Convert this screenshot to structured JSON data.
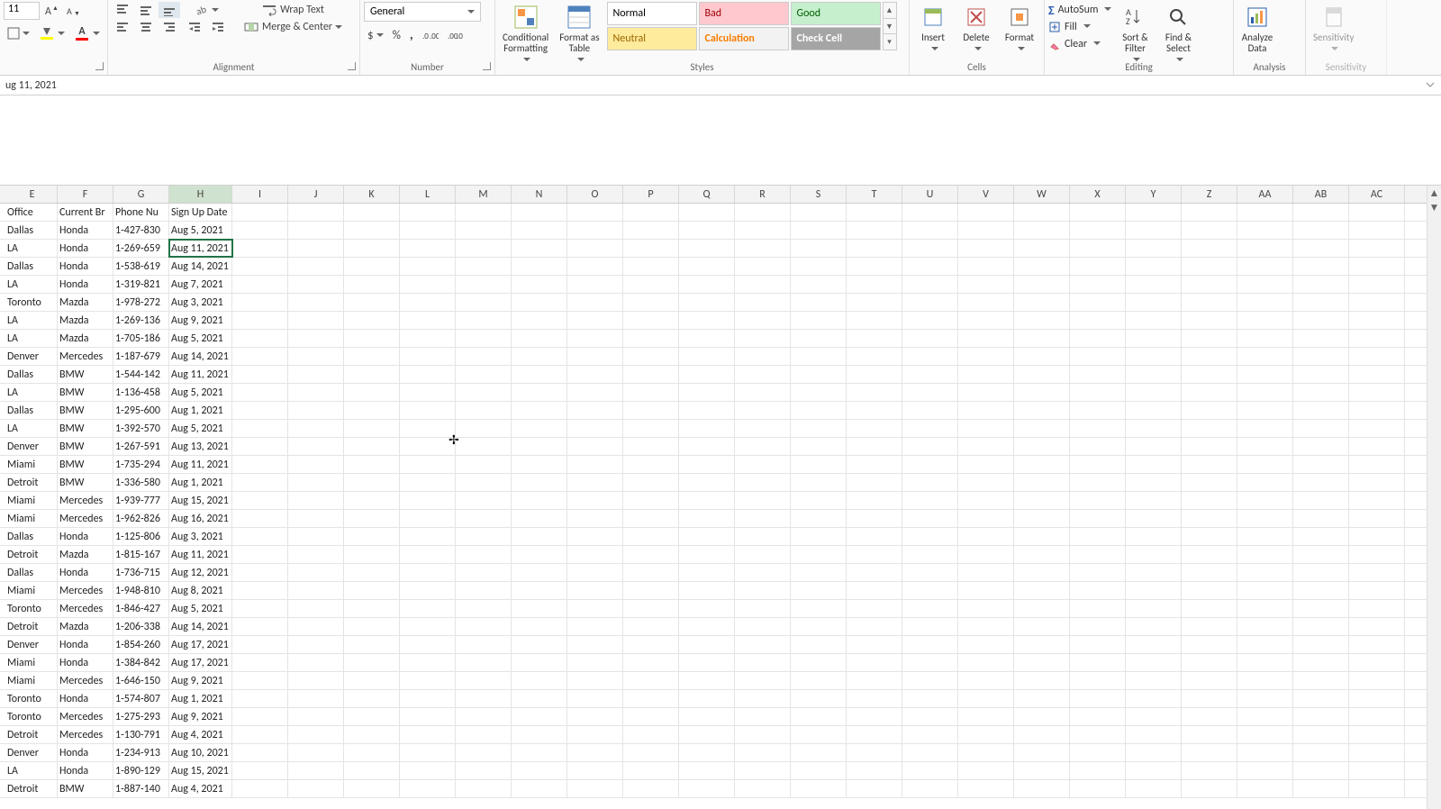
{
  "font": {
    "size": "11"
  },
  "wrap_text_label": "Wrap Text",
  "merge_center_label": "Merge & Center",
  "alignment_label": "Alignment",
  "number_format": "General",
  "number_label": "Number",
  "cond_format_label": "Conditional\nFormatting",
  "format_table_label": "Format as\nTable",
  "styles": {
    "normal": "Normal",
    "bad": "Bad",
    "good": "Good",
    "neutral": "Neutral",
    "calculation": "Calculation",
    "check_cell": "Check Cell",
    "group_label": "Styles"
  },
  "cells": {
    "insert": "Insert",
    "delete": "Delete",
    "format": "Format",
    "group_label": "Cells"
  },
  "editing": {
    "autosum": "AutoSum",
    "fill": "Fill",
    "clear": "Clear",
    "sort": "Sort &\nFilter",
    "find": "Find &\nSelect",
    "group_label": "Editing"
  },
  "analysis": {
    "analyze": "Analyze\nData",
    "group_label": "Analysis"
  },
  "sensitivity": {
    "label": "Sensitivity",
    "group_label": "Sensitivity"
  },
  "formula_bar": "ug 11, 2021",
  "columns": [
    "E",
    "F",
    "G",
    "H",
    "I",
    "J",
    "K",
    "L",
    "M",
    "N",
    "O",
    "P",
    "Q",
    "R",
    "S",
    "T",
    "U",
    "V",
    "W",
    "X",
    "Y",
    "Z",
    "AA",
    "AB",
    "AC"
  ],
  "selected_column": "H",
  "header_row": {
    "E": "Office",
    "F": "Current Br",
    "G": "Phone Nu",
    "H": "Sign Up Date"
  },
  "rows": [
    {
      "E": "Dallas",
      "F": "Honda",
      "G": "1-427-830",
      "H": "Aug 5, 2021"
    },
    {
      "E": "LA",
      "F": "Honda",
      "G": "1-269-659",
      "H": "Aug 11, 2021",
      "selected": true
    },
    {
      "E": "Dallas",
      "F": "Honda",
      "G": "1-538-619",
      "H": "Aug 14, 2021"
    },
    {
      "E": "LA",
      "F": "Honda",
      "G": "1-319-821",
      "H": "Aug 7, 2021"
    },
    {
      "E": "Toronto",
      "F": "Mazda",
      "G": "1-978-272",
      "H": "Aug 3, 2021"
    },
    {
      "E": "LA",
      "F": "Mazda",
      "G": "1-269-136",
      "H": "Aug 9, 2021"
    },
    {
      "E": "LA",
      "F": "Mazda",
      "G": "1-705-186",
      "H": "Aug 5, 2021"
    },
    {
      "E": "Denver",
      "F": "Mercedes",
      "G": "1-187-679",
      "H": "Aug 14, 2021"
    },
    {
      "E": "Dallas",
      "F": "BMW",
      "G": "1-544-142",
      "H": "Aug 11, 2021"
    },
    {
      "E": "LA",
      "F": "BMW",
      "G": "1-136-458",
      "H": "Aug 5, 2021"
    },
    {
      "E": "Dallas",
      "F": "BMW",
      "G": "1-295-600",
      "H": "Aug 1, 2021"
    },
    {
      "E": "LA",
      "F": "BMW",
      "G": "1-392-570",
      "H": "Aug 5, 2021"
    },
    {
      "E": "Denver",
      "F": "BMW",
      "G": "1-267-591",
      "H": "Aug 13, 2021"
    },
    {
      "E": "Miami",
      "F": "BMW",
      "G": "1-735-294",
      "H": "Aug 11, 2021"
    },
    {
      "E": "Detroit",
      "F": "BMW",
      "G": "1-336-580",
      "H": "Aug 1, 2021"
    },
    {
      "E": "Miami",
      "F": "Mercedes",
      "G": "1-939-777",
      "H": "Aug 15, 2021"
    },
    {
      "E": "Miami",
      "F": "Mercedes",
      "G": "1-962-826",
      "H": "Aug 16, 2021"
    },
    {
      "E": "Dallas",
      "F": "Honda",
      "G": "1-125-806",
      "H": "Aug 3, 2021"
    },
    {
      "E": "Detroit",
      "F": "Mazda",
      "G": "1-815-167",
      "H": "Aug 11, 2021"
    },
    {
      "E": "Dallas",
      "F": "Honda",
      "G": "1-736-715",
      "H": "Aug 12, 2021"
    },
    {
      "E": "Miami",
      "F": "Mercedes",
      "G": "1-948-810",
      "H": "Aug 8, 2021"
    },
    {
      "E": "Toronto",
      "F": "Mercedes",
      "G": "1-846-427",
      "H": "Aug 5, 2021"
    },
    {
      "E": "Detroit",
      "F": "Mazda",
      "G": "1-206-338",
      "H": "Aug 14, 2021"
    },
    {
      "E": "Denver",
      "F": "Honda",
      "G": "1-854-260",
      "H": "Aug 17, 2021"
    },
    {
      "E": "Miami",
      "F": "Honda",
      "G": "1-384-842",
      "H": "Aug 17, 2021"
    },
    {
      "E": "Miami",
      "F": "Mercedes",
      "G": "1-646-150",
      "H": "Aug 9, 2021"
    },
    {
      "E": "Toronto",
      "F": "Honda",
      "G": "1-574-807",
      "H": "Aug 1, 2021"
    },
    {
      "E": "Toronto",
      "F": "Mercedes",
      "G": "1-275-293",
      "H": "Aug 9, 2021"
    },
    {
      "E": "Detroit",
      "F": "Mercedes",
      "G": "1-130-791",
      "H": "Aug 4, 2021"
    },
    {
      "E": "Denver",
      "F": "Honda",
      "G": "1-234-913",
      "H": "Aug 10, 2021"
    },
    {
      "E": "LA",
      "F": "Honda",
      "G": "1-890-129",
      "H": "Aug 15, 2021"
    },
    {
      "E": "Detroit",
      "F": "BMW",
      "G": "1-887-140",
      "H": "Aug 4, 2021"
    }
  ]
}
